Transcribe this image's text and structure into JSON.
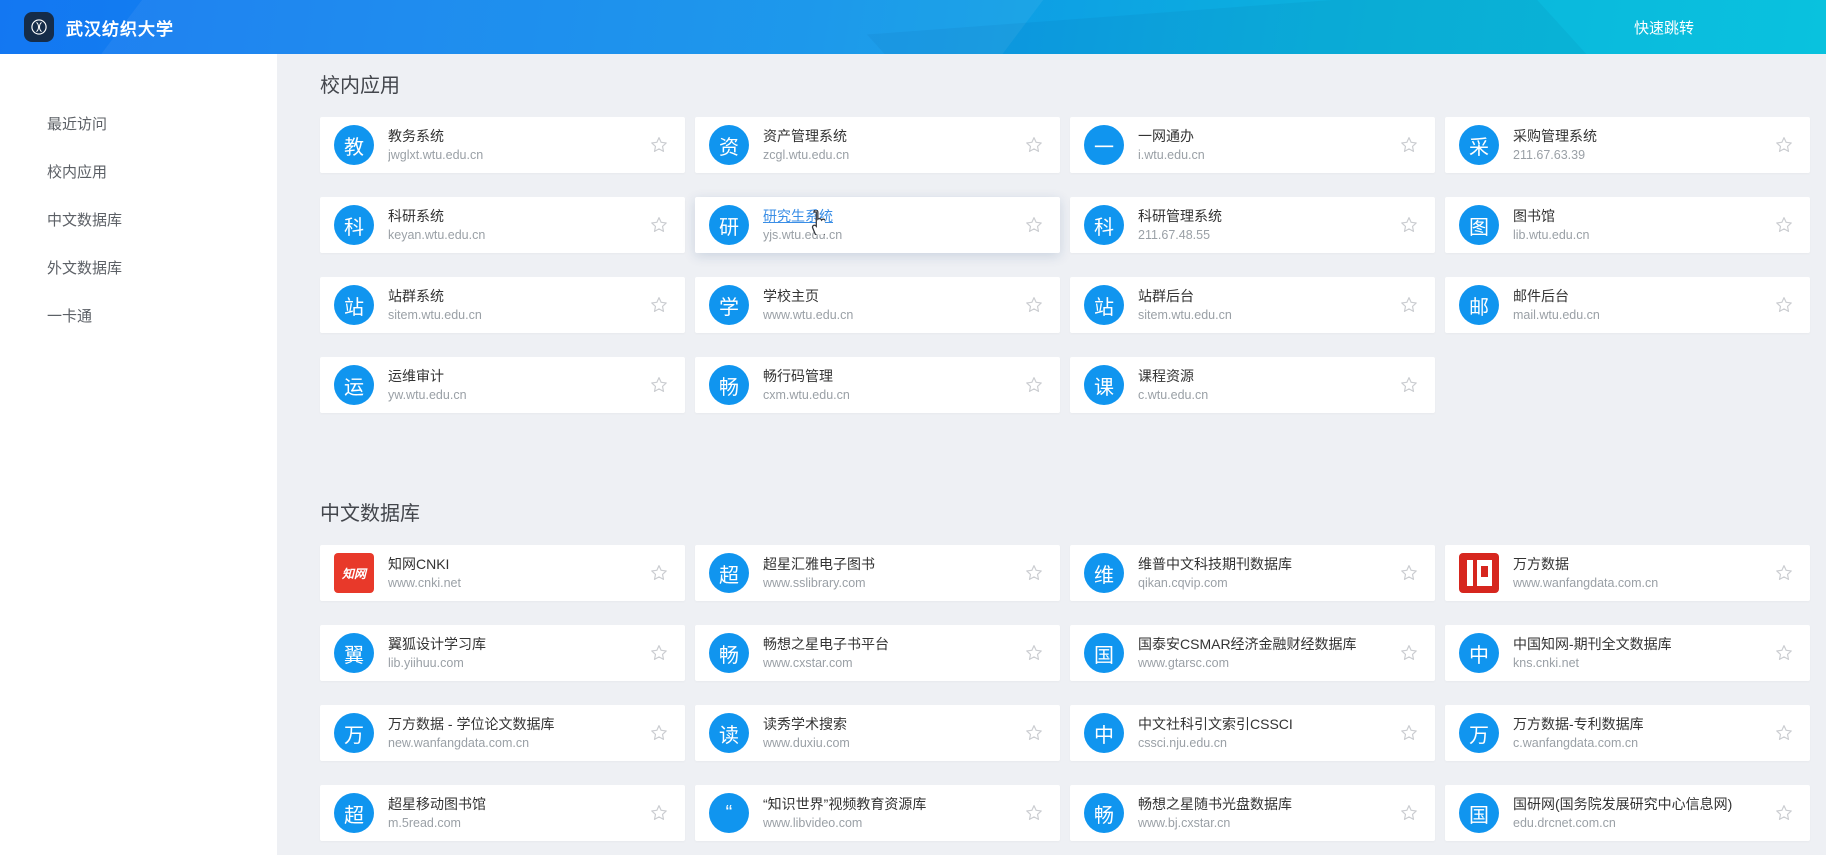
{
  "topbar": {
    "school_name": "武汉纺织大学",
    "quick_jump_label": "快速跳转"
  },
  "sidebar": {
    "items": [
      {
        "label": "最近访问"
      },
      {
        "label": "校内应用"
      },
      {
        "label": "中文数据库"
      },
      {
        "label": "外文数据库"
      },
      {
        "label": "一卡通"
      }
    ]
  },
  "sections": [
    {
      "title": "校内应用",
      "cards": [
        {
          "icon": "教",
          "icon_type": "blue",
          "title": "教务系统",
          "url": "jwglxt.wtu.edu.cn"
        },
        {
          "icon": "资",
          "icon_type": "blue",
          "title": "资产管理系统",
          "url": "zcgl.wtu.edu.cn"
        },
        {
          "icon": "一",
          "icon_type": "blue",
          "title": "一网通办",
          "url": "i.wtu.edu.cn"
        },
        {
          "icon": "采",
          "icon_type": "blue",
          "title": "采购管理系统",
          "url": "211.67.63.39"
        },
        {
          "icon": "科",
          "icon_type": "blue",
          "title": "科研系统",
          "url": "keyan.wtu.edu.cn"
        },
        {
          "icon": "研",
          "icon_type": "blue",
          "title": "研究生系统",
          "url": "yjs.wtu.edu.cn",
          "hovered": true
        },
        {
          "icon": "科",
          "icon_type": "blue",
          "title": "科研管理系统",
          "url": "211.67.48.55"
        },
        {
          "icon": "图",
          "icon_type": "blue",
          "title": "图书馆",
          "url": "lib.wtu.edu.cn"
        },
        {
          "icon": "站",
          "icon_type": "blue",
          "title": "站群系统",
          "url": "sitem.wtu.edu.cn"
        },
        {
          "icon": "学",
          "icon_type": "blue",
          "title": "学校主页",
          "url": "www.wtu.edu.cn"
        },
        {
          "icon": "站",
          "icon_type": "blue",
          "title": "站群后台",
          "url": "sitem.wtu.edu.cn"
        },
        {
          "icon": "邮",
          "icon_type": "blue",
          "title": "邮件后台",
          "url": "mail.wtu.edu.cn"
        },
        {
          "icon": "运",
          "icon_type": "blue",
          "title": "运维审计",
          "url": "yw.wtu.edu.cn"
        },
        {
          "icon": "畅",
          "icon_type": "blue",
          "title": "畅行码管理",
          "url": "cxm.wtu.edu.cn"
        },
        {
          "icon": "课",
          "icon_type": "blue",
          "title": "课程资源",
          "url": "c.wtu.edu.cn"
        }
      ]
    },
    {
      "title": "中文数据库",
      "cards": [
        {
          "icon": "知网",
          "icon_type": "cnki",
          "title": "知网CNKI",
          "url": "www.cnki.net"
        },
        {
          "icon": "超",
          "icon_type": "blue",
          "title": "超星汇雅电子图书",
          "url": "www.sslibrary.com"
        },
        {
          "icon": "维",
          "icon_type": "blue",
          "title": "维普中文科技期刊数据库",
          "url": "qikan.cqvip.com"
        },
        {
          "icon": "",
          "icon_type": "wanfang",
          "title": "万方数据",
          "url": "www.wanfangdata.com.cn"
        },
        {
          "icon": "翼",
          "icon_type": "blue",
          "title": "翼狐设计学习库",
          "url": "lib.yiihuu.com"
        },
        {
          "icon": "畅",
          "icon_type": "blue",
          "title": "畅想之星电子书平台",
          "url": "www.cxstar.com"
        },
        {
          "icon": "国",
          "icon_type": "blue",
          "title": "国泰安CSMAR经济金融财经数据库",
          "url": "www.gtarsc.com"
        },
        {
          "icon": "中",
          "icon_type": "blue",
          "title": "中国知网-期刊全文数据库",
          "url": "kns.cnki.net"
        },
        {
          "icon": "万",
          "icon_type": "blue",
          "title": "万方数据 - 学位论文数据库",
          "url": "new.wanfangdata.com.cn"
        },
        {
          "icon": "读",
          "icon_type": "blue",
          "title": "读秀学术搜索",
          "url": "www.duxiu.com"
        },
        {
          "icon": "中",
          "icon_type": "blue",
          "title": "中文社科引文索引CSSCI",
          "url": "cssci.nju.edu.cn"
        },
        {
          "icon": "万",
          "icon_type": "blue",
          "title": "万方数据-专利数据库",
          "url": "c.wanfangdata.com.cn"
        },
        {
          "icon": "超",
          "icon_type": "blue",
          "title": "超星移动图书馆",
          "url": "m.5read.com"
        },
        {
          "icon": "“",
          "icon_type": "blue",
          "title": "“知识世界”视频教育资源库",
          "url": "www.libvideo.com"
        },
        {
          "icon": "畅",
          "icon_type": "blue",
          "title": "畅想之星随书光盘数据库",
          "url": "www.bj.cxstar.cn"
        },
        {
          "icon": "国",
          "icon_type": "blue",
          "title": "国研网(国务院发展研究中心信息网)",
          "url": "edu.drcnet.com.cn"
        }
      ]
    }
  ],
  "colors": {
    "topbar_gradient_start": "#1377f2",
    "topbar_gradient_end": "#09c2de",
    "app_icon_blue": "#1095ef",
    "cnki_red": "#e8392a",
    "wanfang_red": "#d6261e",
    "hover_link_blue": "#3a8ee6",
    "page_background": "#eef0f4"
  }
}
